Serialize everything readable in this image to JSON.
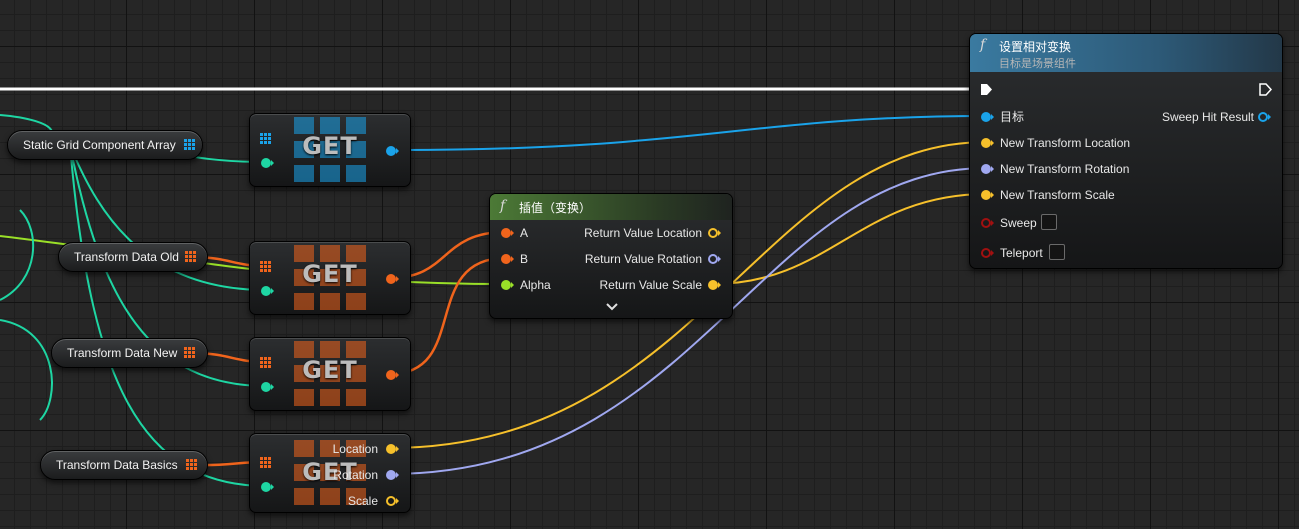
{
  "colors": {
    "exec": "#ffffff",
    "object": "#1aa3ea",
    "struct": "#f0641c",
    "int": "#1ed6a3",
    "vector": "#f6c02b",
    "rotator": "#a0a8f0",
    "float": "#9ae028",
    "bool": "#8c0000",
    "hit": "#1aa3ea"
  },
  "vars": {
    "static_grid": "Static Grid Component Array",
    "transform_old": "Transform Data Old",
    "transform_new": "Transform Data New",
    "transform_basics": "Transform Data Basics"
  },
  "get_nodes": {
    "get1": "GET",
    "get2": "GET",
    "get3": "GET",
    "get4": "GET",
    "get4_pins": {
      "location": "Location",
      "rotation": "Rotation",
      "scale": "Scale"
    }
  },
  "lerp": {
    "title": "插值（变换）",
    "icon": "f",
    "inputs": {
      "a": "A",
      "b": "B",
      "alpha": "Alpha"
    },
    "outputs": {
      "location": "Return Value Location",
      "rotation": "Return Value Rotation",
      "scale": "Return Value Scale"
    },
    "expand_icon": "chevron-down-icon"
  },
  "set_transform": {
    "title": "设置相对变换",
    "subtitle": "目标是场景组件",
    "icon": "f",
    "target": "目标",
    "sweep_hit": "Sweep Hit Result",
    "new_location": "New Transform Location",
    "new_rotation": "New Transform Rotation",
    "new_scale": "New Transform Scale",
    "sweep": "Sweep",
    "teleport": "Teleport"
  }
}
